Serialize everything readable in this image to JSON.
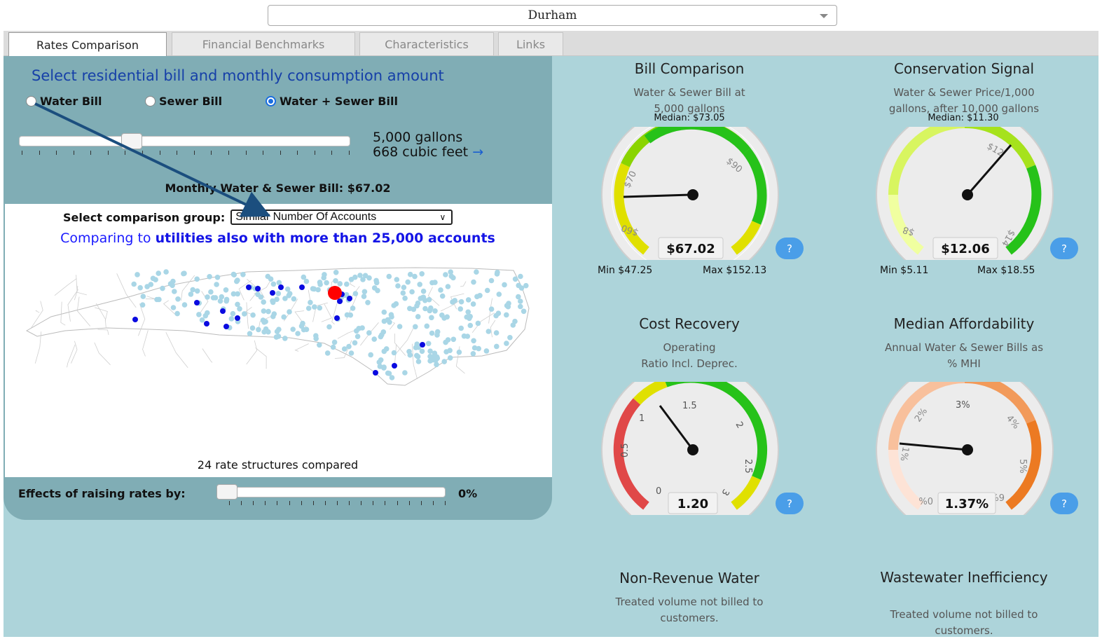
{
  "utility": {
    "selected": "Durham"
  },
  "tabs": [
    {
      "label": "Rates Comparison",
      "active": true
    },
    {
      "label": "Financial Benchmarks",
      "active": false
    },
    {
      "label": "Characteristics",
      "active": false
    },
    {
      "label": "Links",
      "active": false
    }
  ],
  "left": {
    "title": "Select residential bill and monthly consumption amount",
    "radios": [
      {
        "label": "Water Bill",
        "checked": false
      },
      {
        "label": "Sewer Bill",
        "checked": false
      },
      {
        "label": "Water + Sewer Bill",
        "checked": true
      }
    ],
    "consumption_gallons": "5,000 gallons",
    "consumption_cubic": "668 cubic feet",
    "consumption_arrow": "→",
    "consumption_slider_fraction": 0.33,
    "monthly_bill": "Monthly Water & Sewer Bill: $67.02",
    "comparison_label": "Select comparison group:",
    "comparison_value": "Similar Number Of Accounts",
    "comparing_prefix": "Comparing to",
    "comparing_bold": "utilities also with more than 25,000 accounts",
    "rate_structures": "24 rate structures compared",
    "effects_label": "Effects of raising rates by:",
    "effects_value": "0%",
    "effects_slider_fraction": 0
  },
  "gauges": [
    {
      "title": "Bill Comparison",
      "sub1": "Water & Sewer Bill at",
      "sub2": "5,000 gallons",
      "median": "Median: $73.05",
      "value_text": "$67.02",
      "min": "Min $47.25",
      "max": "Max $152.13",
      "help": "?",
      "ticks": [
        "$60",
        "$70",
        "$90"
      ]
    },
    {
      "title": "Conservation Signal",
      "sub1": "Water & Sewer Price/1,000",
      "sub2": "gallons, after 10,000 gallons",
      "median": "Median: $11.30",
      "value_text": "$12.06",
      "min": "Min $5.11",
      "max": "Max $18.55",
      "help": "?",
      "ticks": [
        "$8",
        "$12",
        "$14"
      ]
    },
    {
      "title": "Cost Recovery",
      "sub1": "Operating",
      "sub2": "Ratio Incl. Deprec.",
      "value_text": "1.20",
      "help": "?",
      "ticks": [
        "0",
        "0.5",
        "1",
        "1.5",
        "2",
        "2.5",
        "3"
      ]
    },
    {
      "title": "Median Affordability",
      "sub1": "Annual Water & Sewer Bills as",
      "sub2": "% MHI",
      "value_text": "1.37%",
      "help": "?",
      "ticks": [
        "0%",
        "1%",
        "2%",
        "3%",
        "4%",
        "5%",
        "6%"
      ]
    },
    {
      "title": "Non-Revenue Water",
      "sub1": "Treated volume not billed to",
      "sub2": "customers."
    },
    {
      "title": "Wastewater Inefficiency",
      "sub1": "Treated volume not billed to",
      "sub2": "customers."
    }
  ],
  "colors": {
    "panel": "#80adb5",
    "background": "#add4da",
    "title_blue": "#1640a8",
    "highlight_red": "#ff0000"
  }
}
